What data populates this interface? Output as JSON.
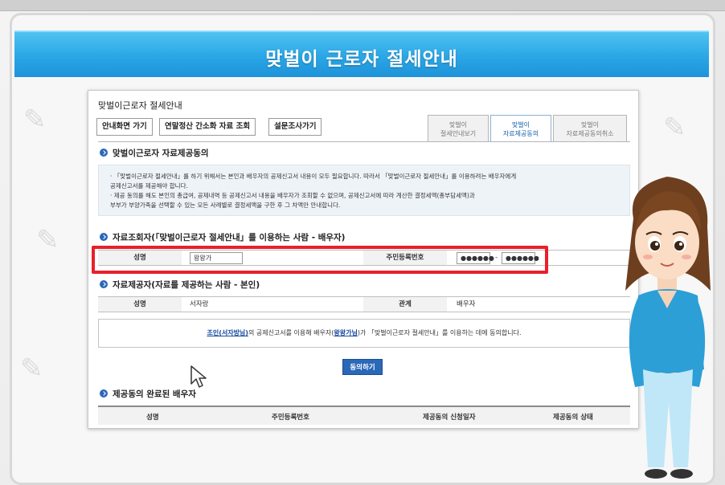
{
  "banner": {
    "title": "맞벌이 근로자 절세안내"
  },
  "screen": {
    "title": "맞벌이근로자 절세안내",
    "buttons": [
      "안내화면 가기",
      "연말정산 간소화 자료 조회",
      "설문조사가기"
    ],
    "tabs": [
      {
        "line1": "맞벌이",
        "line2": "절세안내보기"
      },
      {
        "line1": "맞벌이",
        "line2": "자료제공동의"
      },
      {
        "line1": "맞벌이",
        "line2": "자료제공동의취소"
      }
    ],
    "section1": {
      "heading": "맞벌이근로자 자료제공동의",
      "notice_line1": "· 「맞벌이근로자 절세안내」를 하기 위해서는 본인과 배우자의 공제신고서 내용이 모두 필요합니다. 따라서 「맞벌이근로자 절세안내」를 이용하려는 배우자에게",
      "notice_line2": "  공제신고서를 제공해야 합니다.",
      "notice_line3": "· 제공 동의를 해도 본인의 총급여, 공제내역 등 공제신고서 내용을 배우자가 조회할 수 없으며, 공제신고서에 따라 계산한 결정세액(총부담세액)과",
      "notice_line4": "  부부가 부양가족을 선택할 수 있는 모든 사례별로 결정세액을 구한 후 그 차액만 안내합니다."
    },
    "section2": {
      "heading": "자료조회자(「맞벌이근로자 절세안내」를 이용하는 사람 - 배우자)",
      "name_label": "성명",
      "name_value": "왕왕가",
      "rrn_label": "주민등록번호",
      "rrn_part1": "●●●●●●",
      "rrn_dash": "-",
      "rrn_part2": "●●●●●●"
    },
    "section3": {
      "heading": "자료제공자(자료를 제공하는 사람 - 본인)",
      "name_label": "성명",
      "name_value": "서자랑",
      "relation_label": "관계",
      "relation_value": "배우자"
    },
    "consent": {
      "pre": "",
      "self_link": "조인(서자방님)",
      "mid": "의 공제신고서를 이용해 배우자(",
      "spouse_link": "왕왕가님",
      "post": ")가 「맞벌이근로자 절세안내」를 이용하는 데에 동의합니다."
    },
    "agree_button": "동의하기",
    "section4": {
      "heading": "제공동의 완료된 배우자",
      "columns": [
        "성명",
        "주민등록번호",
        "제공동의 신청일자",
        "제공동의 상태"
      ]
    }
  }
}
